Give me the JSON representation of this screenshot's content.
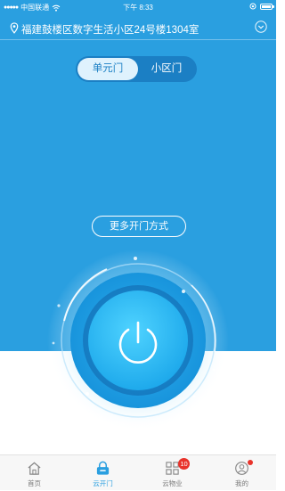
{
  "status_bar": {
    "signal": "●●●●●",
    "carrier": "中国联通",
    "time": "下午 8:33"
  },
  "address": {
    "text": "福建鼓楼区数字生活小区24号楼1304室",
    "pin_icon": "location-pin-icon",
    "dropdown_icon": "chevron-down-circle-icon"
  },
  "door_tabs": {
    "unit_door": "单元门",
    "community_door": "小区门",
    "selected": "单元门"
  },
  "more_button": "更多开门方式",
  "power_icon": "power-icon",
  "tab_bar": {
    "items": [
      {
        "label": "首页",
        "icon": "home-icon"
      },
      {
        "label": "云开门",
        "icon": "door-lock-icon"
      },
      {
        "label": "云物业",
        "icon": "property-grid-icon",
        "badge": "10"
      },
      {
        "label": "我的",
        "icon": "profile-icon"
      }
    ],
    "active_index": 1
  },
  "colors": {
    "primary": "#2a9fe0",
    "segment_bg": "#1b7fc4",
    "badge": "#e8332b"
  }
}
